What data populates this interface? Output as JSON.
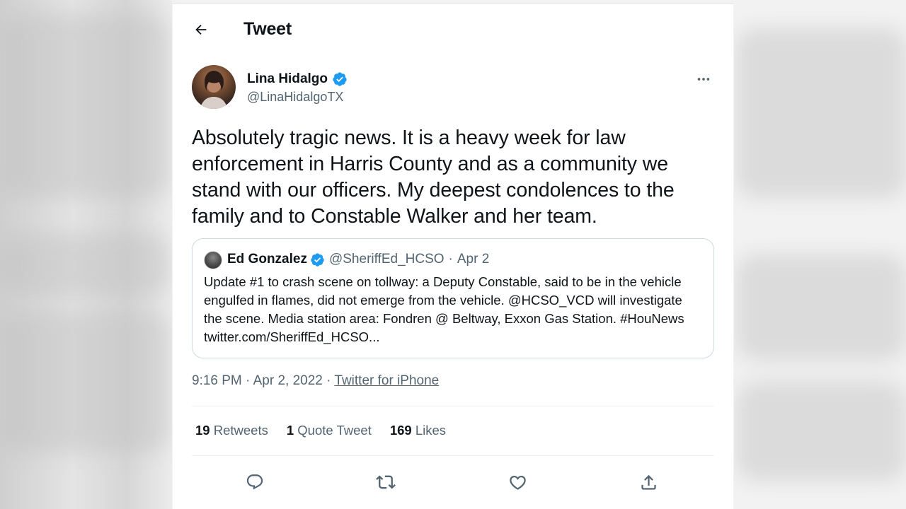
{
  "header": {
    "title": "Tweet"
  },
  "author": {
    "name": "Lina Hidalgo",
    "handle": "@LinaHidalgoTX",
    "verified": true
  },
  "tweet": {
    "text": "Absolutely tragic news. It is a heavy week for law enforcement in Harris County and as a community we stand with our officers. My deepest condolences to the family and to Constable Walker and her team."
  },
  "quote": {
    "name": "Ed Gonzalez",
    "handle": "@SheriffEd_HCSO",
    "date": "Apr 2",
    "text": "Update #1 to crash scene on tollway: a Deputy Constable, said to be in the vehicle engulfed in flames, did not emerge from the vehicle. @HCSO_VCD will investigate the scene. Media station area: Fondren @ Beltway, Exxon Gas Station. #HouNews twitter.com/SheriffEd_HCSO..."
  },
  "meta": {
    "time": "9:16 PM",
    "date": "Apr 2, 2022",
    "source": "Twitter for iPhone"
  },
  "stats": {
    "retweets_count": "19",
    "retweets_label": "Retweets",
    "quotes_count": "1",
    "quotes_label": "Quote Tweet",
    "likes_count": "169",
    "likes_label": "Likes"
  },
  "actions": [
    "reply-icon",
    "retweet-icon",
    "like-icon",
    "share-icon"
  ],
  "colors": {
    "verified": "#1d9bf0",
    "text_primary": "#0f1419",
    "text_secondary": "#536471",
    "border": "#cfd9de"
  }
}
